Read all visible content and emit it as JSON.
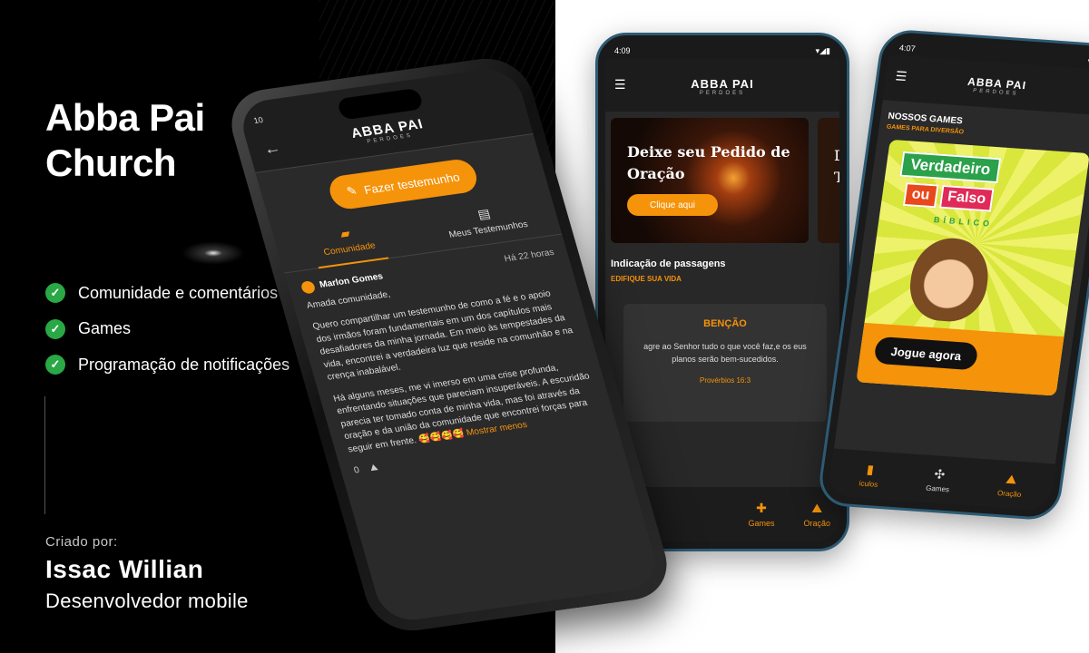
{
  "promo": {
    "title_line1": "Abba Pai",
    "title_line2": "Church",
    "features": [
      "Comunidade e comentários",
      "Games",
      "Programação de notificações"
    ],
    "credit_label": "Criado por:",
    "credit_name": "Issac Willian",
    "credit_role": "Desenvolvedor mobile"
  },
  "colors": {
    "accent": "#f5930a",
    "check": "#29a845",
    "background_left": "#000000",
    "background_right": "#ffffff"
  },
  "logo": {
    "name": "ABBA PAI",
    "sub": "PERDOES"
  },
  "phone_community": {
    "status_time": "10",
    "cta_label": "Fazer testemunho",
    "tabs": [
      {
        "label": "Comunidade",
        "icon": "chat-bubble-icon",
        "active": true
      },
      {
        "label": "Meus Testemunhos",
        "icon": "notes-icon",
        "active": false
      }
    ],
    "post": {
      "author": "Marlon Gomes",
      "time": "Há 22 horas",
      "greeting": "Amada comunidade,",
      "paragraph1": "Quero compartilhar um testemunho de como a fé e o apoio dos irmãos foram fundamentais em um dos capítulos mais desafiadores da minha jornada. Em meio às tempestades da vida, encontrei a verdadeira luz que reside na comunhão e na crença inabalável.",
      "paragraph2": "Há alguns meses, me vi imerso em uma crise profunda, enfrentando situações que pareciam insuperáveis. A escuridão parecia ter tomado conta de minha vida, mas foi através da oração e da união da comunidade que encontrei forças para seguir em frente.",
      "emojis": "🥰🥰🥰🥰",
      "more_label": "Mostrar menos",
      "likes": "0"
    }
  },
  "phone_home": {
    "status_time": "4:09",
    "card_title": "Deixe seu Pedido de Oração",
    "card_button": "Clique aqui",
    "section_title": "Indicação de passagens",
    "section_sub": "EDIFIQUE SUA VIDA",
    "bencao_title": "BENÇÃO",
    "bencao_text": "agre ao Senhor tudo o que você faz,e os eus planos serão bem-sucedidos.",
    "bencao_ref": "Provérbios 16:3",
    "nav": [
      {
        "label": "Games",
        "icon": "gamepad-icon"
      },
      {
        "label": "Oração",
        "icon": "praying-hands-icon"
      }
    ]
  },
  "phone_games": {
    "status_time": "4:07",
    "section_title": "NOSSOS GAMES",
    "section_sub": "GAMES PARA DIVERSÃO",
    "game_title_1": "Verdadeiro",
    "game_title_ou": "ou",
    "game_title_falso": "Falso",
    "game_subtitle": "BÍBLICO",
    "play_button": "Jogue agora",
    "nav": [
      {
        "label": "ículos",
        "icon": "book-icon"
      },
      {
        "label": "Games",
        "icon": "gamepad-icon"
      },
      {
        "label": "Oração",
        "icon": "praying-hands-icon"
      }
    ]
  }
}
